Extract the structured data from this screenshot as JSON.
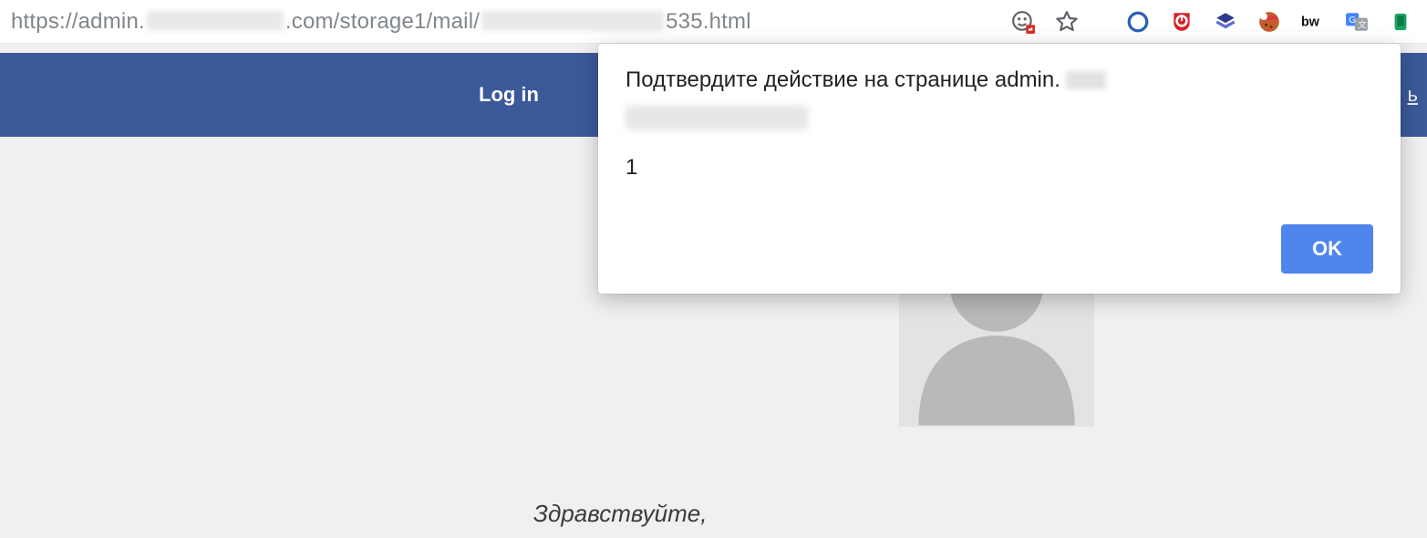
{
  "browser": {
    "url_scheme_host_prefix": "https://admin.",
    "url_mid": ".com/storage1/mail/",
    "url_suffix": "535.html",
    "extensions": [
      "site-permissions-icon",
      "star-icon",
      "circle-extension-icon",
      "ublock-extension-icon",
      "stack-extension-icon",
      "cookie-extension-icon",
      "bw-extension-icon",
      "google-translate-extension-icon",
      "device-extension-icon"
    ]
  },
  "page": {
    "header": {
      "login_label": "Log in",
      "right_link_fragment": "ь"
    },
    "greeting": "Здравствуйте,"
  },
  "dialog": {
    "title_prefix": "Подтвердите действие на странице admin.",
    "message": "1",
    "ok_label": "OK"
  }
}
